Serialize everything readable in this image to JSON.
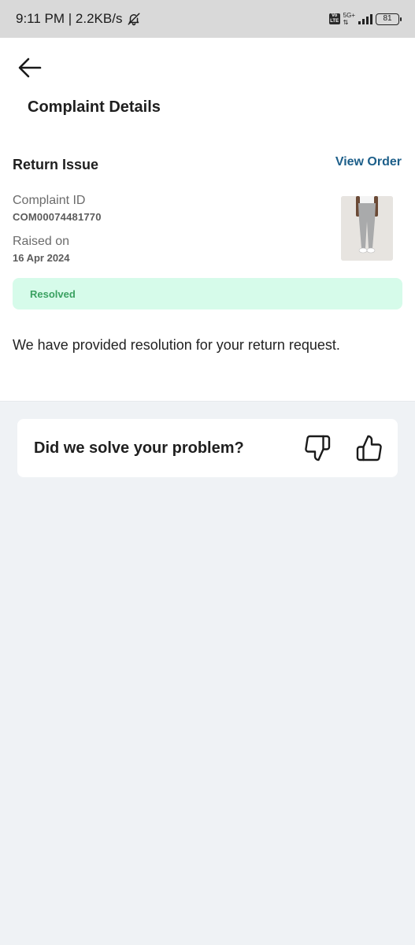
{
  "status_bar": {
    "time_network": "9:11 PM | 2.2KB/s",
    "volte": "Vo LTE",
    "network_type": "5G+",
    "battery": "81"
  },
  "header": {
    "title": "Complaint Details"
  },
  "complaint": {
    "issue_title": "Return Issue",
    "view_order_label": "View Order",
    "complaint_id_label": "Complaint ID",
    "complaint_id_value": "COM00074481770",
    "raised_on_label": "Raised on",
    "raised_on_value": "16 Apr 2024",
    "status": "Resolved",
    "resolution_message": "We have provided resolution for your return request."
  },
  "feedback": {
    "question": "Did we solve your problem?"
  },
  "colors": {
    "accent_link": "#1d5f8a",
    "resolved_bg": "#d6fbea",
    "resolved_text": "#3aa161",
    "page_bg": "#eff2f5"
  },
  "icons": {
    "back": "arrow-left-icon",
    "mute": "bell-off-icon",
    "thumbs_down": "thumbs-down-icon",
    "thumbs_up": "thumbs-up-icon"
  }
}
